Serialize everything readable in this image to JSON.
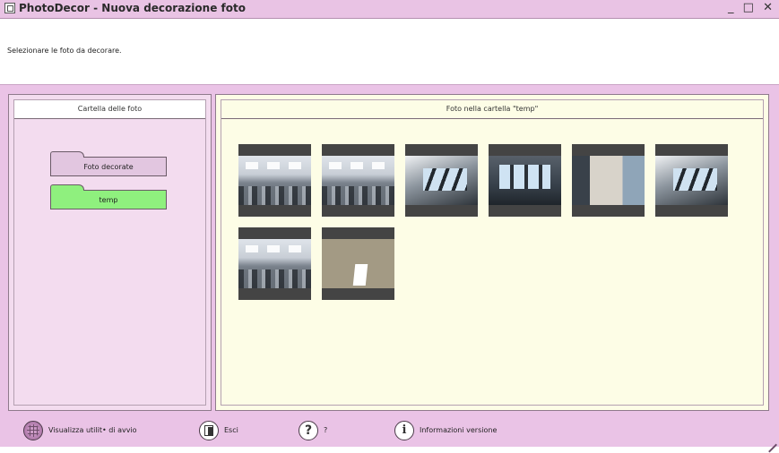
{
  "window": {
    "title": "PhotoDecor - Nuova decorazione foto",
    "controls": {
      "minimize": "_",
      "maximize": "□",
      "close": "✕"
    }
  },
  "instruction": "Selezionare le foto da decorare.",
  "folders_panel": {
    "header": "Cartella delle foto",
    "folders": [
      {
        "label": "Foto decorate",
        "selected": false
      },
      {
        "label": "temp",
        "selected": true
      }
    ]
  },
  "photos_panel": {
    "header": "Foto nella cartella \"temp\"",
    "photo_count": 8
  },
  "footer": {
    "startup_label": "Visualizza utilit• di avvio",
    "exit_label": "Esci",
    "help_label": "?",
    "version_label": "Informazioni versione"
  },
  "colors": {
    "title_bar": "#e9c3e4",
    "main_bg": "#eac3e6",
    "folder_selected": "#8ff07e",
    "photos_bg": "#fdfde6"
  }
}
